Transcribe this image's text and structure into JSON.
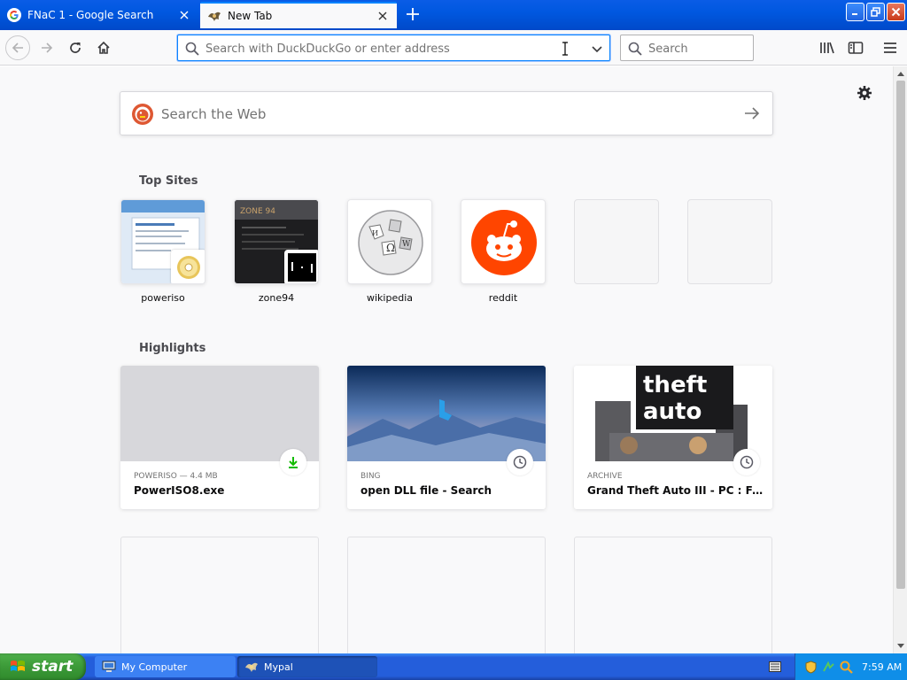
{
  "tabs": [
    {
      "title": "FNaC 1 - Google Search",
      "active": false,
      "favicon": "google-icon"
    },
    {
      "title": "New Tab",
      "active": true,
      "favicon": "mypal-icon"
    }
  ],
  "navbar": {
    "url_placeholder": "Search with DuckDuckGo or enter address",
    "search_placeholder": "Search"
  },
  "newtab": {
    "web_search_placeholder": "Search the Web",
    "top_sites_title": "Top Sites",
    "top_sites": [
      {
        "label": "poweriso"
      },
      {
        "label": "zone94"
      },
      {
        "label": "wikipedia"
      },
      {
        "label": "reddit"
      },
      {
        "label": ""
      },
      {
        "label": ""
      }
    ],
    "highlights_title": "Highlights",
    "highlights": [
      {
        "context": "POWERISO — 4.4 MB",
        "title": "PowerISO8.exe",
        "type": "download"
      },
      {
        "context": "BING",
        "title": "open DLL file - Search",
        "type": "history"
      },
      {
        "context": "ARCHIVE",
        "title": "Grand Theft Auto III - PC : Free ...",
        "type": "history"
      }
    ]
  },
  "taskbar": {
    "start_label": "start",
    "tasks": [
      {
        "label": "My Computer",
        "icon": "my-computer-icon"
      },
      {
        "label": "Mypal",
        "icon": "mypal-icon"
      }
    ],
    "clock": "7:59 AM"
  },
  "colors": {
    "accent": "#0a84ff",
    "reddit": "#ff4500",
    "download_green": "#12bc00",
    "xp_blue": "#245edb",
    "start_green": "#3c9a38"
  }
}
